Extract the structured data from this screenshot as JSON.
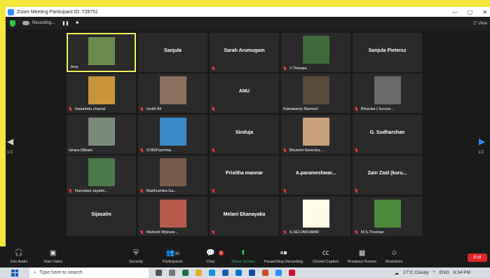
{
  "window": {
    "title": "Zoom Meeting Participant ID: 728751"
  },
  "topbar": {
    "recording_label": "Recording...",
    "view_label": "View"
  },
  "tiles": [
    {
      "name": "Jeny",
      "style": "photo",
      "active": true,
      "muted": false,
      "bg": "#6b8a4c"
    },
    {
      "name": "Sanjula",
      "style": "text",
      "muted": false
    },
    {
      "name": "Sarah Arumugam",
      "style": "text",
      "muted": true
    },
    {
      "name": "V.Thinopa",
      "style": "photo",
      "muted": true,
      "bg": "#3f6a3a"
    },
    {
      "name": "Sanjula Pietersz",
      "style": "text",
      "muted": false
    },
    {
      "name": "hasarindu chamal",
      "style": "photo",
      "muted": true,
      "bg": "#c9953a"
    },
    {
      "name": "Israth Ali",
      "style": "photo",
      "muted": true,
      "bg": "#8a6f5c"
    },
    {
      "name": "ANU",
      "style": "text",
      "muted": true
    },
    {
      "name": "Ramasamy Ramesh",
      "style": "photo",
      "muted": false,
      "bg": "#5a4a3a"
    },
    {
      "name": "Bharuka ( kurune...",
      "style": "photo",
      "muted": true,
      "bg": "#6a6a6a"
    },
    {
      "name": "Ishara Dilhani",
      "style": "photo",
      "muted": false,
      "bg": "#7a8a7a"
    },
    {
      "name": "6780/Fazmina",
      "style": "photo",
      "muted": true,
      "bg": "#3a8ac9"
    },
    {
      "name": "Sinduja",
      "style": "text",
      "muted": true
    },
    {
      "name": "Bhumini Senevira...",
      "style": "photo",
      "muted": true,
      "bg": "#c9a27a"
    },
    {
      "name": "G. Sudharshan",
      "style": "text",
      "muted": true
    },
    {
      "name": "Navodani Jayathi...",
      "style": "photo",
      "muted": true,
      "bg": "#4a7a4a"
    },
    {
      "name": "Madhushika Ga...",
      "style": "photo",
      "muted": true,
      "bg": "#7a5a4a"
    },
    {
      "name": "Prisitha mannar",
      "style": "text",
      "muted": true
    },
    {
      "name": "A.parameshwar...",
      "style": "text",
      "muted": true
    },
    {
      "name": "Zain Zaid (kuru...",
      "style": "text",
      "muted": true
    },
    {
      "name": "Sijasalm",
      "style": "text",
      "muted": false
    },
    {
      "name": "Mahesh Wijewar...",
      "style": "photo",
      "muted": true,
      "bg": "#b85a4a"
    },
    {
      "name": "Melani Ekanayaka",
      "style": "text",
      "muted": true
    },
    {
      "name": "S.SELVAKUMAR",
      "style": "photo",
      "muted": true,
      "bg": "#fffbe6"
    },
    {
      "name": "M.S.Theeban",
      "style": "photo",
      "muted": true,
      "bg": "#4a8a3a"
    }
  ],
  "pagination": {
    "left": "1/2",
    "right": "1/2"
  },
  "toolbar": {
    "join_audio": "Join Audio",
    "start_video": "Start Video",
    "security": "Security",
    "participants": "Participants",
    "participants_count": "30",
    "chat": "Chat",
    "chat_badge": "2",
    "share_screen": "Share Screen",
    "record": "Pause/Stop Recording",
    "cc": "Closed Caption",
    "breakout": "Breakout Rooms",
    "reactions": "Reactions",
    "end": "End"
  },
  "taskbar": {
    "search_placeholder": "Type here to search",
    "weather": "27°C  Cloudy",
    "lang": "ENG",
    "time": "6:34 PM"
  },
  "colors": {
    "accent": "#2d8cff",
    "end": "#e02828",
    "share": "#33c26a",
    "active_border": "#f0f05a"
  }
}
